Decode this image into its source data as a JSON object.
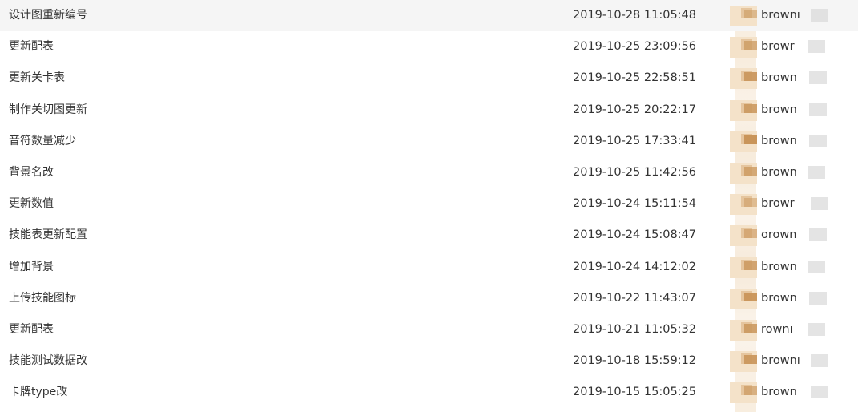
{
  "commits": [
    {
      "message": "设计图重新编号",
      "date": "2019-10-28 11:05:48",
      "author": "brownı"
    },
    {
      "message": "更新配表",
      "date": "2019-10-25 23:09:56",
      "author": "browr"
    },
    {
      "message": "更新关卡表",
      "date": "2019-10-25 22:58:51",
      "author": "brown"
    },
    {
      "message": "制作关切图更新",
      "date": "2019-10-25 20:22:17",
      "author": "brown"
    },
    {
      "message": "音符数量减少",
      "date": "2019-10-25 17:33:41",
      "author": "brown"
    },
    {
      "message": "背景名改",
      "date": "2019-10-25 11:42:56",
      "author": "brown"
    },
    {
      "message": "更新数值",
      "date": "2019-10-24 15:11:54",
      "author": "browr"
    },
    {
      "message": "技能表更新配置",
      "date": "2019-10-24 15:08:47",
      "author": "orown"
    },
    {
      "message": "增加背景",
      "date": "2019-10-24 14:12:02",
      "author": "brown"
    },
    {
      "message": "上传技能图标",
      "date": "2019-10-22 11:43:07",
      "author": "brown"
    },
    {
      "message": "更新配表",
      "date": "2019-10-21 11:05:32",
      "author": "rownı"
    },
    {
      "message": "技能测试数据改",
      "date": "2019-10-18 15:59:12",
      "author": "brownı"
    },
    {
      "message": "卡牌type改",
      "date": "2019-10-15 15:05:25",
      "author": "brown"
    }
  ],
  "avatar_colors": {
    "light": "#f4e2c9",
    "mid": "#e2c096",
    "dark": "#c9955a"
  }
}
